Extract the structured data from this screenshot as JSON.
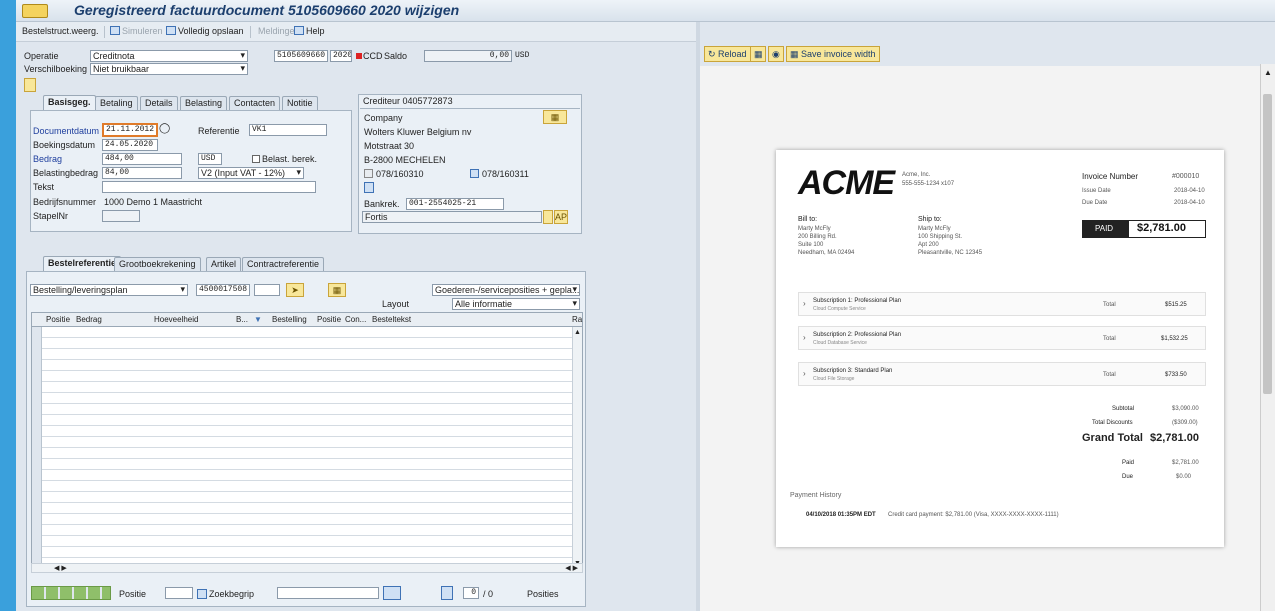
{
  "window": {
    "title": "Geregistreerd factuurdocument 5105609660 2020 wijzigen"
  },
  "toolbar": {
    "items": [
      {
        "label": "Bestelstruct.weerg.",
        "enabled": true
      },
      {
        "label": "Simuleren",
        "enabled": false
      },
      {
        "label": "Volledig opslaan",
        "enabled": true
      },
      {
        "label": "Meldingen",
        "enabled": false
      },
      {
        "label": "Help",
        "enabled": true
      }
    ]
  },
  "header": {
    "operatie_label": "Operatie",
    "operatie_value": "Creditnota",
    "verschilboeking_label": "Verschilboeking",
    "verschilboeking_value": "Niet bruikbaar",
    "doc_number": "5105609660",
    "doc_year": "2020",
    "status_light": "CCD",
    "saldo_label": "Saldo",
    "saldo_value": "0,00",
    "saldo_currency": "USD"
  },
  "tabs_top": [
    "Basisgeg.",
    "Betaling",
    "Details",
    "Belasting",
    "Contacten",
    "Notitie"
  ],
  "basic": {
    "documentdatum_label": "Documentdatum",
    "documentdatum_value": "21.11.2012",
    "referentie_label": "Referentie",
    "referentie_value": "VK1",
    "boekingsdatum_label": "Boekingsdatum",
    "boekingsdatum_value": "24.05.2020",
    "bedrag_label": "Bedrag",
    "bedrag_value": "484,00",
    "bedrag_currency": "USD",
    "belast_label": "Belast. berek.",
    "belastingbedrag_label": "Belastingbedrag",
    "belastingbedrag_value": "84,00",
    "taxcode_value": "V2 (Input VAT - 12%)",
    "tekst_label": "Tekst",
    "tekst_value": "",
    "bedrijfsnummer_label": "Bedrijfsnummer",
    "bedrijfsnummer_value": "1000 Demo 1 Maastricht",
    "stapelnr_label": "StapelNr",
    "stapelnr_value": ""
  },
  "vendor": {
    "title": "Crediteur 0405772873",
    "company": "Company",
    "name": "Wolters Kluwer Belgium nv",
    "street": "Motstraat 30",
    "city": "B-2800 MECHELEN",
    "phone": "078/160310",
    "fax": "078/160311",
    "bank_label": "Bankrek.",
    "bank_value": "001-2554025-21",
    "bank_name": "Fortis",
    "ap_label": "AP"
  },
  "tabs_bottom": [
    "Bestelreferentie",
    "Grootboekrekening",
    "Artikel",
    "Contractreferentie"
  ],
  "order": {
    "type_value": "Bestelling/leveringsplan",
    "po_value": "4500017508",
    "goods_value": "Goederen-/serviceposities + gepla...",
    "layout_label": "Layout",
    "layout_value": "Alle informatie"
  },
  "grid": {
    "columns": [
      "Positie",
      "Bedrag",
      "Hoeveelheid",
      "B...",
      "Bestelling",
      "Positie",
      "Con...",
      "Besteltekst",
      "Ra"
    ],
    "row_count": 22
  },
  "footer": {
    "positie_label": "Positie",
    "positie_value": "",
    "zoekbegrip_label": "Zoekbegrip",
    "zoekbegrip_value": "",
    "page_value": "0",
    "page_total": "/ 0",
    "posities_label": "Posities"
  },
  "viewer": {
    "buttons": [
      {
        "label": "Reload"
      },
      {
        "label": ""
      },
      {
        "label": ""
      },
      {
        "label": "Save invoice width"
      }
    ]
  },
  "invoice": {
    "logo": "ACME",
    "company_name": "Acme, Inc.",
    "company_phone": "555-555-1234 x107",
    "invoice_number_label": "Invoice Number",
    "invoice_number": "#000010",
    "issue_date_label": "Issue Date",
    "issue_date": "2018-04-10",
    "due_date_label": "Due Date",
    "due_date": "2018-04-10",
    "bill_to_label": "Bill to:",
    "bill_to": [
      "Marty McFly",
      "200 Billing Rd.",
      "Suite 100",
      "Needham, MA 02494"
    ],
    "ship_to_label": "Ship to:",
    "ship_to": [
      "Marty McFly",
      "100 Shipping St.",
      "Apt 200",
      "Pleasantville, NC 12345"
    ],
    "paid_label": "PAID",
    "paid_amount": "$2,781.00",
    "items": [
      {
        "name": "Subscription 1: Professional Plan",
        "desc": "Cloud Compute Service",
        "total_label": "Total",
        "total": "$515.25"
      },
      {
        "name": "Subscription 2: Professional Plan",
        "desc": "Cloud Database Service",
        "total_label": "Total",
        "total": "$1,532.25"
      },
      {
        "name": "Subscription 3: Standard Plan",
        "desc": "Cloud File Storage",
        "total_label": "Total",
        "total": "$733.50"
      }
    ],
    "subtotal_label": "Subtotal",
    "subtotal": "$3,090.00",
    "discounts_label": "Total Discounts",
    "discounts": "($309.00)",
    "grand_total_label": "Grand Total",
    "grand_total": "$2,781.00",
    "paid_row_label": "Paid",
    "paid_row": "$2,781.00",
    "due_row_label": "Due",
    "due_row": "$0.00",
    "history_label": "Payment History",
    "history_entry_time": "04/10/2018 01:35PM EDT",
    "history_entry_text": "Credit card payment: $2,781.00 (Visa, XXXX-XXXX-XXXX-1111)"
  }
}
